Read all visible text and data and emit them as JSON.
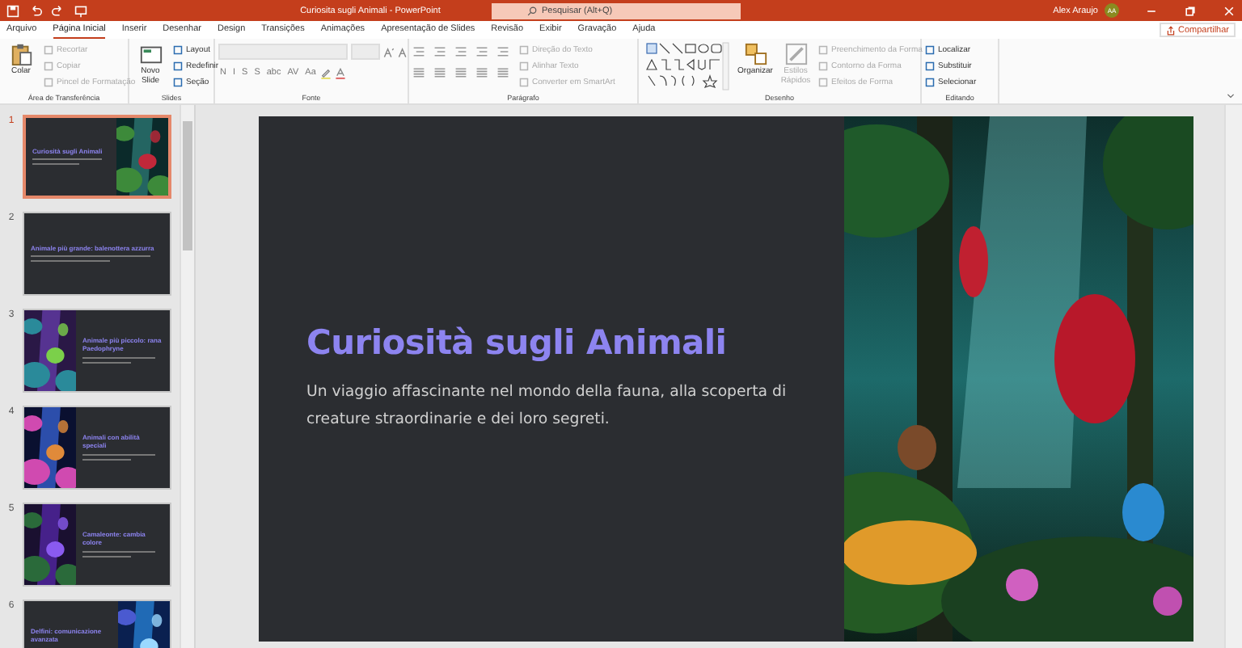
{
  "titlebar": {
    "title": "Curiosita sugli Animali  -  PowerPoint",
    "search": {
      "placeholder": "Pesquisar (Alt+Q)"
    },
    "user": "Alex Araujo",
    "avatar": "AA"
  },
  "tabs": [
    {
      "label": "Arquivo",
      "selected": false
    },
    {
      "label": "Página Inicial",
      "selected": true
    },
    {
      "label": "Inserir",
      "selected": false
    },
    {
      "label": "Desenhar",
      "selected": false
    },
    {
      "label": "Design",
      "selected": false
    },
    {
      "label": "Transições",
      "selected": false
    },
    {
      "label": "Animações",
      "selected": false
    },
    {
      "label": "Apresentação de Slides",
      "selected": false
    },
    {
      "label": "Revisão",
      "selected": false
    },
    {
      "label": "Exibir",
      "selected": false
    },
    {
      "label": "Gravação",
      "selected": false
    },
    {
      "label": "Ajuda",
      "selected": false
    }
  ],
  "share_button": "Compartilhar",
  "ribbon": {
    "groups": [
      {
        "label": "Área de Transferência",
        "columns": [
          [
            {
              "kind": "large",
              "label": "Colar",
              "disabled": false
            }
          ],
          [
            {
              "kind": "small",
              "label": "Recortar",
              "disabled": true
            },
            {
              "kind": "small",
              "label": "Copiar",
              "disabled": true
            },
            {
              "kind": "small",
              "label": "Pincel de Formatação",
              "disabled": true
            }
          ]
        ]
      },
      {
        "label": "Slides",
        "columns": [
          [
            {
              "kind": "large",
              "label": "Novo Slide",
              "disabled": false
            }
          ],
          [
            {
              "kind": "small",
              "label": "Layout",
              "disabled": false
            },
            {
              "kind": "small",
              "label": "Redefinir",
              "disabled": false
            },
            {
              "kind": "small",
              "label": "Seção",
              "disabled": false
            }
          ]
        ]
      },
      {
        "label": "Fonte",
        "columns": [
          [
            {
              "kind": "font-fields"
            },
            {
              "kind": "glyphs",
              "glyphs": [
                "N",
                "I",
                "S",
                "S",
                "abc",
                "AV",
                "Aa"
              ]
            }
          ]
        ]
      },
      {
        "label": "Parágrafo",
        "columns": [
          [
            {
              "kind": "paragraph-tools"
            }
          ],
          [
            {
              "kind": "small",
              "label": "Direção do Texto",
              "disabled": true
            },
            {
              "kind": "small",
              "label": "Alinhar Texto",
              "disabled": true
            },
            {
              "kind": "small",
              "label": "Converter em SmartArt",
              "disabled": true
            }
          ]
        ]
      },
      {
        "label": "Desenho",
        "columns": [
          [
            {
              "kind": "shape-gallery"
            }
          ],
          [
            {
              "kind": "large",
              "label": "Organizar",
              "disabled": false
            }
          ],
          [
            {
              "kind": "large",
              "label": "Estilos Rápidos",
              "disabled": true
            }
          ],
          [
            {
              "kind": "small",
              "label": "Preenchimento da Forma",
              "disabled": true
            },
            {
              "kind": "small",
              "label": "Contorno da Forma",
              "disabled": true
            },
            {
              "kind": "small",
              "label": "Efeitos de Forma",
              "disabled": true
            }
          ]
        ]
      },
      {
        "label": "Editando",
        "columns": [
          [
            {
              "kind": "small",
              "label": "Localizar",
              "disabled": false
            },
            {
              "kind": "small",
              "label": "Substituir",
              "disabled": false
            },
            {
              "kind": "small",
              "label": "Selecionar",
              "disabled": false
            }
          ]
        ]
      }
    ]
  },
  "thumbnails": [
    {
      "number": "1",
      "title": "Curiosità sugli Animali",
      "kind": "picture-right",
      "selected": true
    },
    {
      "number": "2",
      "title": "Animale più grande: balenottera azzurra",
      "kind": "text",
      "selected": false
    },
    {
      "number": "3",
      "title": "Animale più piccolo: rana Paedophryne",
      "kind": "picture-left",
      "selected": false
    },
    {
      "number": "4",
      "title": "Animali con abilità speciali",
      "kind": "picture-left",
      "selected": false
    },
    {
      "number": "5",
      "title": "Camaleonte: cambia colore",
      "kind": "picture-left",
      "selected": false
    },
    {
      "number": "6",
      "title": "Delfini: comunicazione avanzata",
      "kind": "picture-right",
      "selected": false
    }
  ],
  "slide": {
    "title": "Curiosità sugli Animali",
    "subtitle": "Un viaggio affascinante nel mondo della fauna, alla scoperta di creature straordinarie e dei loro segreti.",
    "kind": "picture-right"
  }
}
